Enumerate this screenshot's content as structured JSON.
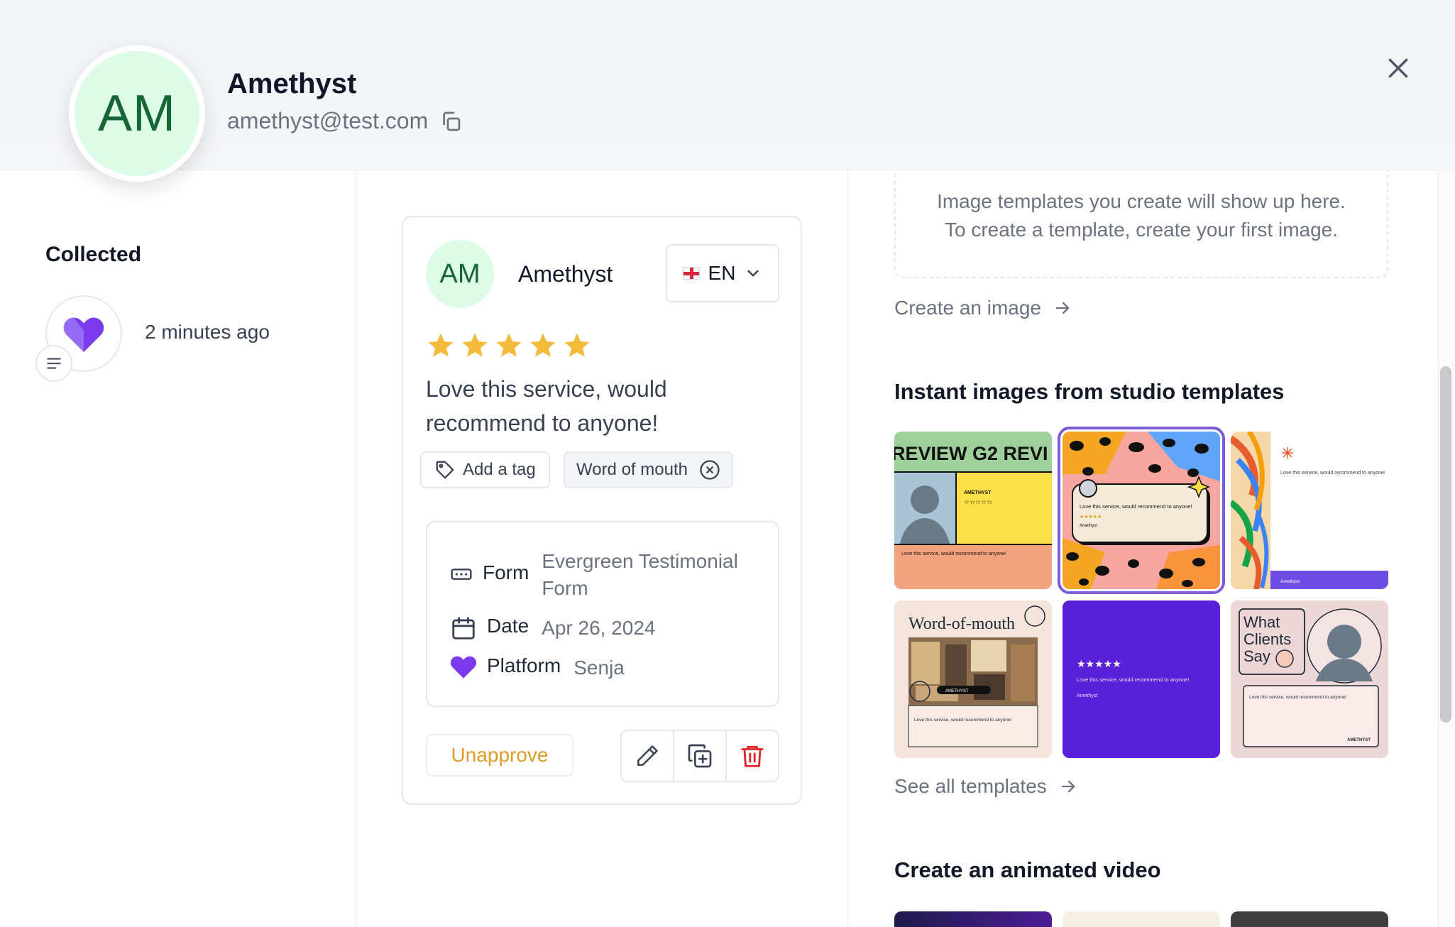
{
  "header": {
    "initials": "AM",
    "name": "Amethyst",
    "email": "amethyst@test.com"
  },
  "left": {
    "collected_title": "Collected",
    "collected_time": "2 minutes ago"
  },
  "card": {
    "initials": "AM",
    "name": "Amethyst",
    "language": "EN",
    "rating": 5,
    "review": "Love this service, would recommend to anyone!",
    "add_tag_label": "Add a tag",
    "tags": [
      "Word of mouth"
    ],
    "meta": {
      "form_label": "Form",
      "form_value": "Evergreen Testimonial Form",
      "date_label": "Date",
      "date_value": "Apr 26, 2024",
      "platform_label": "Platform",
      "platform_value": "Senja"
    },
    "unapprove_label": "Unapprove"
  },
  "right": {
    "empty_line1": "Image templates you create will show up here.",
    "empty_line2": "To create a template, create your first image.",
    "create_image_label": "Create an image",
    "instant_title": "Instant images from studio templates",
    "see_all_label": "See all templates",
    "video_title": "Create an animated video",
    "templates": {
      "t1_banner": "REVIEW G2 REVI",
      "t1_name": "AMETHYST",
      "t1_text": "Love this service, would recommend to anyone!",
      "t2_text": "Love this service, would recommend to anyone!",
      "t2_name": "Amethyst",
      "t3_text": "Love this service, would recommend to anyone!",
      "t3_name": "Amethyst",
      "t4_title": "Word-of-mouth",
      "t4_name": "AMETHYST",
      "t4_text": "Love this service, would recommend to anyone!",
      "t5_stars": "★★★★★",
      "t5_text": "Love this service, would recommend to anyone!",
      "t5_name": "Amethyst",
      "t6_title_1": "What",
      "t6_title_2": "Clients",
      "t6_title_3": "Say",
      "t6_text": "Love this service, would recommend to anyone!",
      "t6_name": "AMETHYST"
    }
  },
  "colors": {
    "star": "#f5b93b",
    "heart": "#7c3aed",
    "delete": "#dc2626",
    "unapprove": "#e09b2a",
    "selected_outline": "#7c5cd6"
  }
}
